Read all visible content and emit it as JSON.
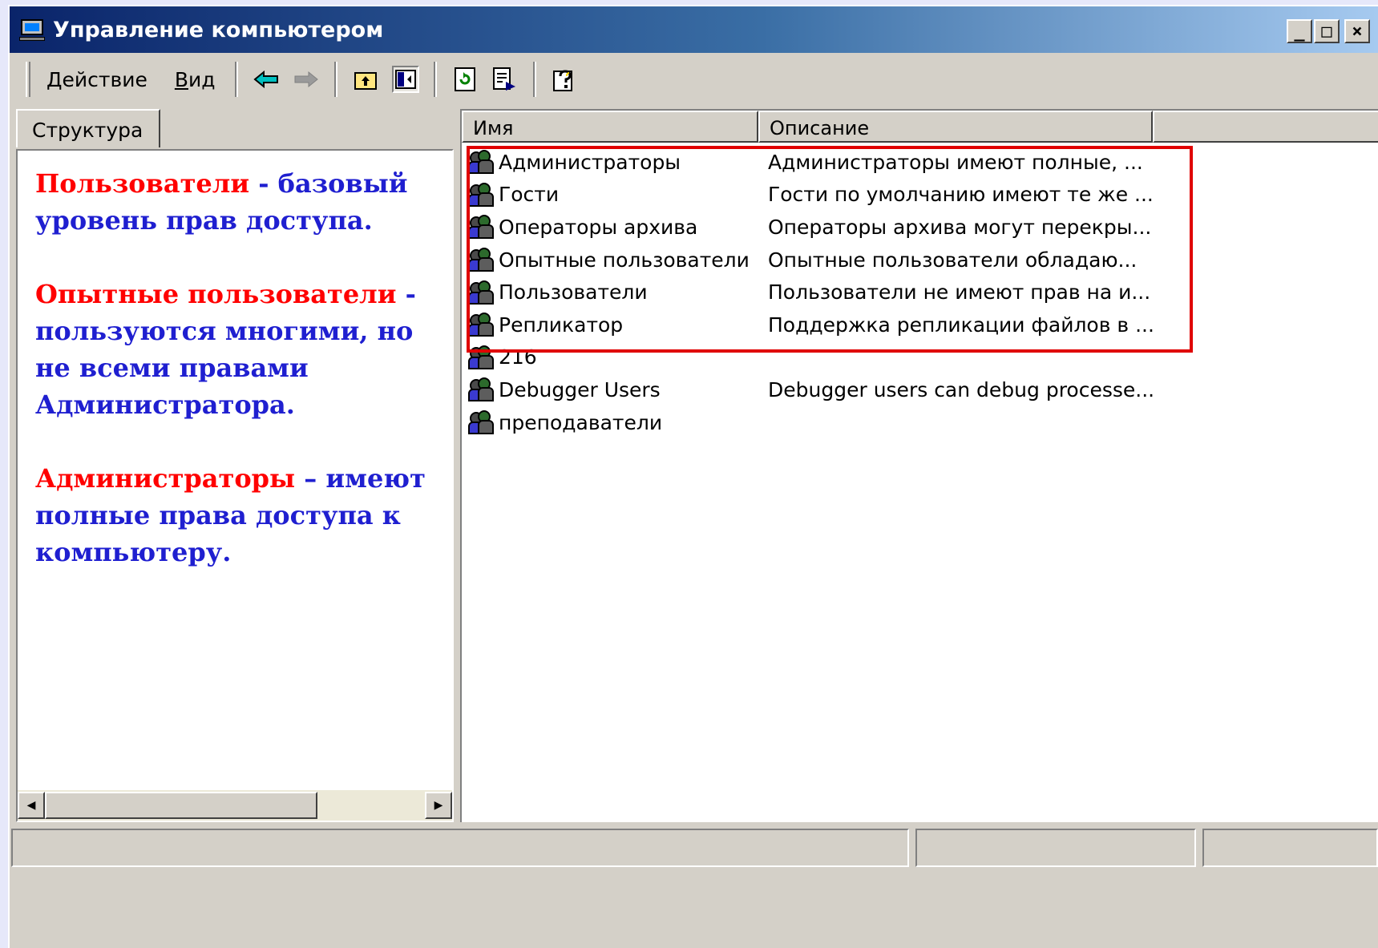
{
  "window": {
    "title": "Управление компьютером",
    "controls": {
      "minimize": "_",
      "maximize": "□",
      "close": "×"
    }
  },
  "toolbar": {
    "action_menu": "Действие",
    "view_menu_first": "В",
    "view_menu_rest": "ид",
    "icons": [
      "back-arrow-icon",
      "forward-arrow-icon",
      "up-folder-icon",
      "show-hide-tree-icon",
      "refresh-icon",
      "export-list-icon",
      "help-icon"
    ]
  },
  "left": {
    "tab_label": "Структура",
    "notes": [
      {
        "term": "Пользователи",
        "text": " - базовый уровень прав доступа."
      },
      {
        "term": "Опытные пользователи",
        "text": " - пользуются многими, но не всеми правами Администратора."
      },
      {
        "term": "Администраторы",
        "text": " – имеют полные права доступа к компьютеру."
      }
    ]
  },
  "list": {
    "columns": [
      "Имя",
      "Описание",
      ""
    ],
    "rows": [
      {
        "name": "Администраторы",
        "desc": "Администраторы имеют полные, ..."
      },
      {
        "name": "Гости",
        "desc": "Гости по умолчанию имеют те же ..."
      },
      {
        "name": "Операторы архива",
        "desc": "Операторы архива могут перекры..."
      },
      {
        "name": "Опытные пользователи",
        "desc": "Опытные пользователи обладаю..."
      },
      {
        "name": "Пользователи",
        "desc": "Пользователи не имеют прав на и..."
      },
      {
        "name": "Репликатор",
        "desc": "Поддержка репликации файлов в ..."
      },
      {
        "name": "216",
        "desc": ""
      },
      {
        "name": "Debugger Users",
        "desc": "Debugger users can debug processe..."
      },
      {
        "name": "преподаватели",
        "desc": ""
      }
    ]
  },
  "colors": {
    "highlight_border": "#e00000",
    "term_color": "#ff0000",
    "note_color": "#1f1fd0"
  }
}
